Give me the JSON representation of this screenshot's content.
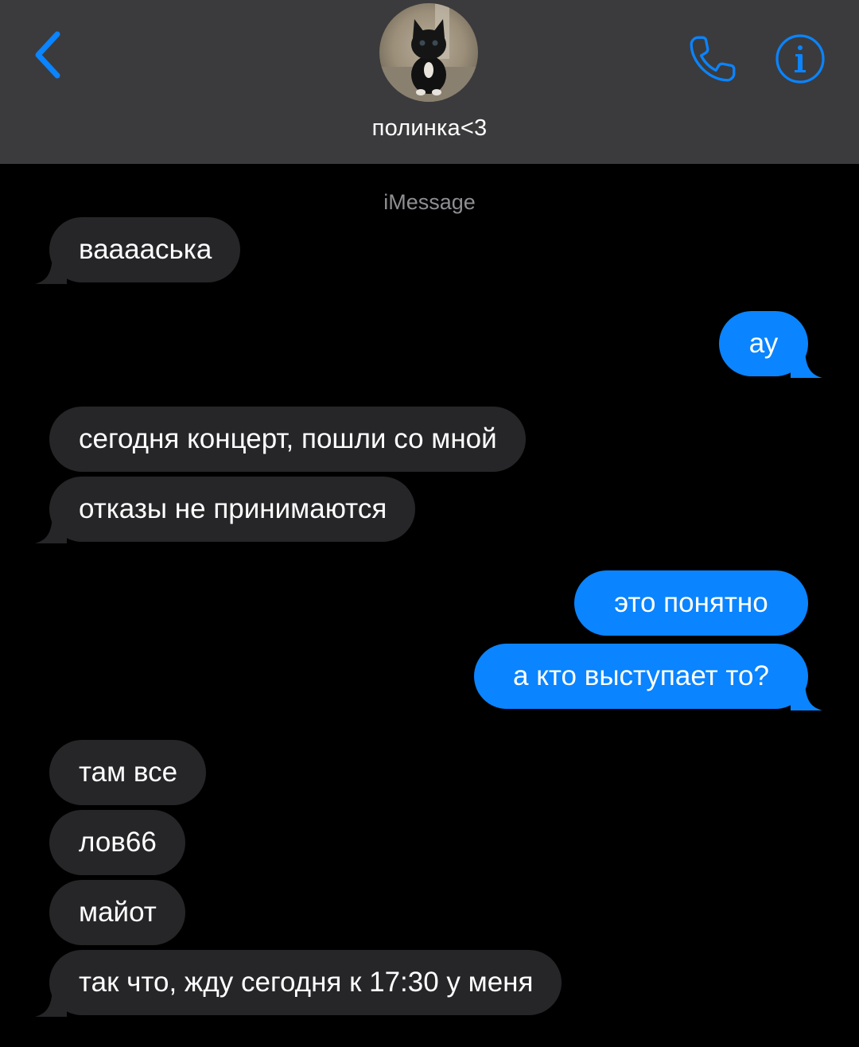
{
  "header": {
    "contact_name": "полинка<3",
    "accent_color": "#0a84ff",
    "back_icon": "chevron-left-icon",
    "call_icon": "phone-icon",
    "info_icon": "info-icon"
  },
  "service_label": "iMessage",
  "messages": [
    {
      "direction": "incoming",
      "text": "вааааська"
    },
    {
      "direction": "outgoing",
      "text": "ау"
    },
    {
      "direction": "incoming",
      "text": "сегодня концерт, пошли со мной"
    },
    {
      "direction": "incoming",
      "text": "отказы не принимаются"
    },
    {
      "direction": "outgoing",
      "text": "это понятно"
    },
    {
      "direction": "outgoing",
      "text": "а кто выступает то?"
    },
    {
      "direction": "incoming",
      "text": "там все"
    },
    {
      "direction": "incoming",
      "text": "лов66"
    },
    {
      "direction": "incoming",
      "text": "майот"
    },
    {
      "direction": "incoming",
      "text": "так что, жду сегодня к 17:30 у меня"
    }
  ],
  "colors": {
    "incoming_bubble": "#262629",
    "outgoing_bubble": "#0a84ff",
    "header_bg": "#3b3b3d"
  }
}
